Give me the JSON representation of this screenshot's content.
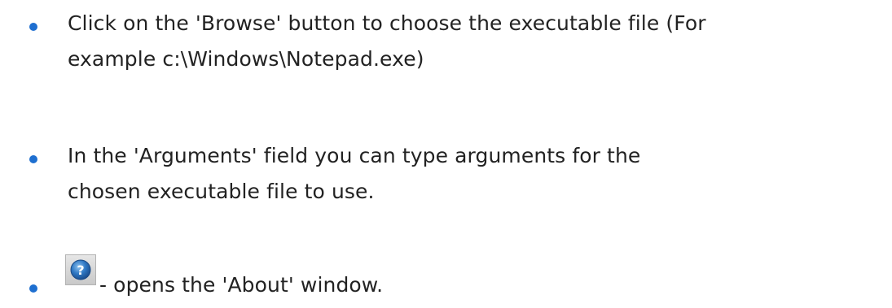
{
  "items": [
    {
      "lines": [
        "Click on the 'Browse' button to choose the executable file (For",
        "example c:\\Windows\\Notepad.exe)"
      ]
    },
    {
      "lines": [
        "In the 'Arguments' field you can type arguments for the",
        "chosen executable file to use."
      ]
    },
    {
      "icon": "help-icon",
      "text": "- opens the 'About' window."
    }
  ],
  "colors": {
    "bullet": "#1e6fd0",
    "text": "#222222",
    "icon_blue": "#2f78c4"
  }
}
